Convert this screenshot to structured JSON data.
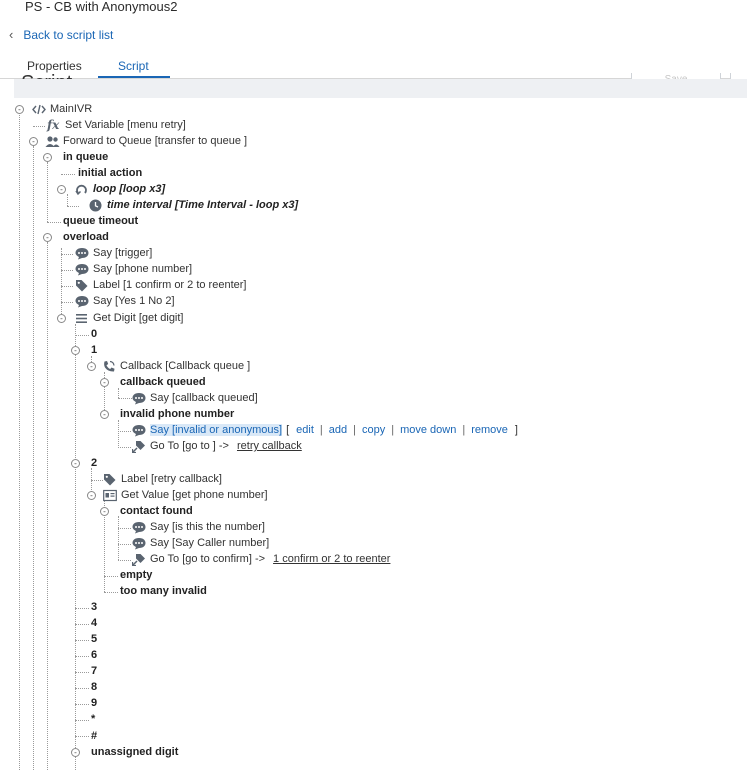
{
  "window": {
    "title": "PS - CB with Anonymous2"
  },
  "nav": {
    "back_label": "Back to script list"
  },
  "tabs": [
    {
      "label": "Properties"
    },
    {
      "label": "Script"
    }
  ],
  "page": {
    "heading": "Script"
  },
  "toolbar": {
    "save_label": "Save"
  },
  "tree": {
    "root": "MainIVR",
    "set_variable": "Set Variable [menu retry]",
    "forward": "Forward to Queue [transfer to queue ]",
    "in_queue": "in queue",
    "initial_action": "initial action",
    "loop": "loop [loop x3]",
    "time_interval": "time interval [Time Interval - loop x3]",
    "queue_timeout": "queue timeout",
    "overload": "overload",
    "say_trigger": "Say [trigger]",
    "say_phone": "Say [phone number]",
    "label_confirm": "Label [1 confirm or 2 to reenter]",
    "say_yes": "Say [Yes 1 No 2]",
    "get_digit": "Get Digit [get digit]",
    "d0": "0",
    "d1": "1",
    "callback": "Callback [Callback queue ]",
    "callback_queued": "callback queued",
    "say_cb_queued": "Say [callback queued]",
    "invalid_phone": "invalid phone number",
    "say_invalid": "Say [invalid or anonymous]",
    "bracket_open": "[",
    "edit": "edit",
    "add": "add",
    "copy": "copy",
    "move_down": "move down",
    "remove": "remove",
    "bracket_close": "]",
    "goto1_prefix": "Go To [go to ] ->",
    "goto1_link": "retry callback",
    "d2": "2",
    "label_retry": "Label [retry callback]",
    "get_value": "Get Value [get phone number]",
    "contact_found": "contact found",
    "say_is_this": "Say [is this the number]",
    "say_caller": "Say [Say Caller number]",
    "goto2_prefix": "Go To [go to confirm] ->",
    "goto2_link": "1 confirm or 2 to reenter",
    "empty": "empty",
    "too_many": "too many invalid",
    "d3": "3",
    "d4": "4",
    "d5": "5",
    "d6": "6",
    "d7": "7",
    "d8": "8",
    "d9": "9",
    "dstar": "*",
    "dhash": "#",
    "unassigned": "unassigned digit"
  },
  "icons": {
    "code": "code-icon",
    "fx": "function-icon",
    "users": "users-icon",
    "loop": "loop-icon",
    "clock": "clock-icon",
    "chat": "speech-bubble-icon",
    "tag": "tag-icon",
    "list": "list-icon",
    "phone": "phone-icon",
    "card": "id-card-icon"
  },
  "colors": {
    "accent": "#1a66b5",
    "highlight": "#d9e8f7",
    "toolbar": "#eef0f3",
    "icon": "#5a6470"
  }
}
